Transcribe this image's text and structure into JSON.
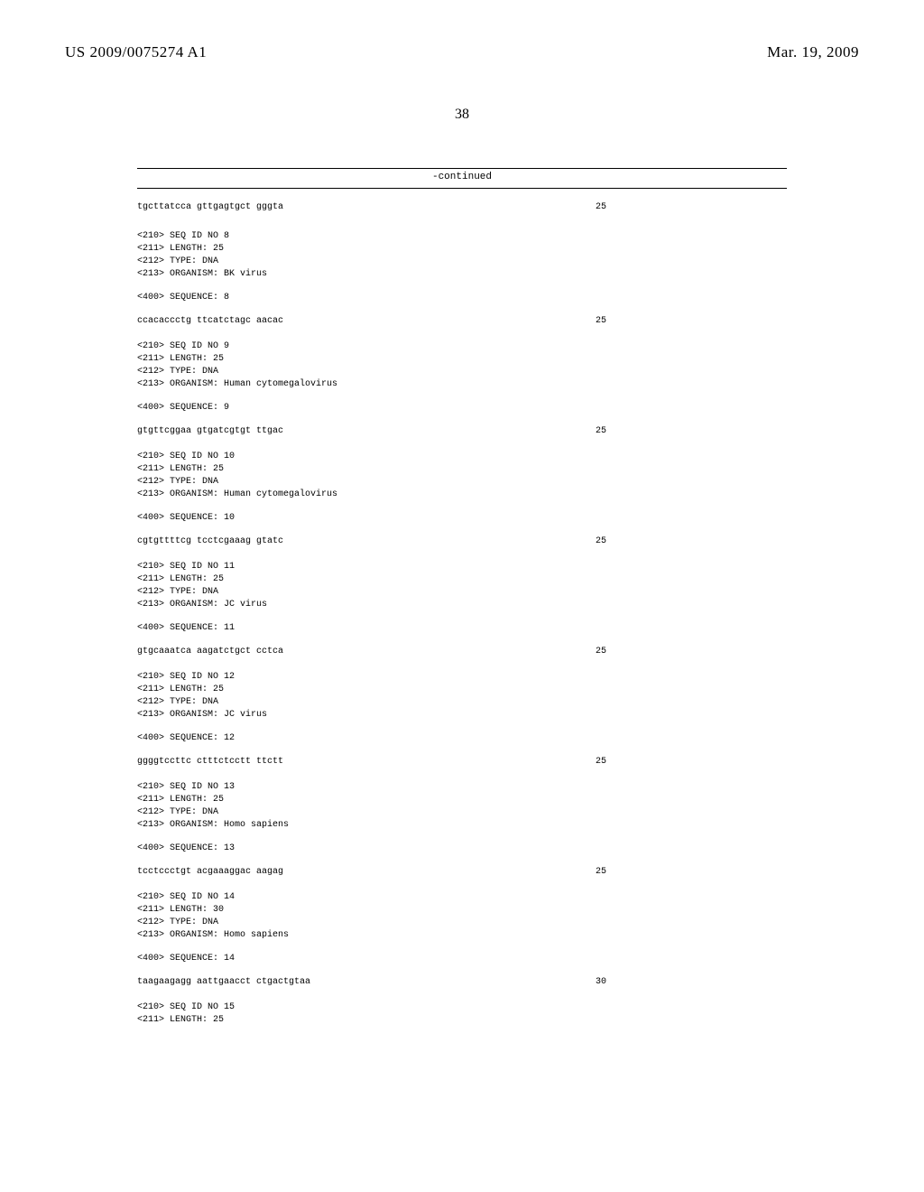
{
  "header": {
    "pub_number": "US 2009/0075274 A1",
    "pub_date": "Mar. 19, 2009"
  },
  "page_number": "38",
  "continued_label": "-continued",
  "first_seq": {
    "sequence": "tgcttatcca gttgagtgct gggta",
    "length": "25"
  },
  "blocks": [
    {
      "id_line": "<210> SEQ ID NO 8",
      "length_line": "<211> LENGTH: 25",
      "type_line": "<212> TYPE: DNA",
      "organism_line": "<213> ORGANISM: BK virus",
      "seq_label": "<400> SEQUENCE: 8",
      "sequence": "ccacaccctg ttcatctagc aacac",
      "length": "25"
    },
    {
      "id_line": "<210> SEQ ID NO 9",
      "length_line": "<211> LENGTH: 25",
      "type_line": "<212> TYPE: DNA",
      "organism_line": "<213> ORGANISM: Human cytomegalovirus",
      "seq_label": "<400> SEQUENCE: 9",
      "sequence": "gtgttcggaa gtgatcgtgt ttgac",
      "length": "25"
    },
    {
      "id_line": "<210> SEQ ID NO 10",
      "length_line": "<211> LENGTH: 25",
      "type_line": "<212> TYPE: DNA",
      "organism_line": "<213> ORGANISM: Human cytomegalovirus",
      "seq_label": "<400> SEQUENCE: 10",
      "sequence": "cgtgttttcg tcctcgaaag gtatc",
      "length": "25"
    },
    {
      "id_line": "<210> SEQ ID NO 11",
      "length_line": "<211> LENGTH: 25",
      "type_line": "<212> TYPE: DNA",
      "organism_line": "<213> ORGANISM: JC virus",
      "seq_label": "<400> SEQUENCE: 11",
      "sequence": "gtgcaaatca aagatctgct cctca",
      "length": "25"
    },
    {
      "id_line": "<210> SEQ ID NO 12",
      "length_line": "<211> LENGTH: 25",
      "type_line": "<212> TYPE: DNA",
      "organism_line": "<213> ORGANISM: JC virus",
      "seq_label": "<400> SEQUENCE: 12",
      "sequence": "ggggtccttc ctttctcctt ttctt",
      "length": "25"
    },
    {
      "id_line": "<210> SEQ ID NO 13",
      "length_line": "<211> LENGTH: 25",
      "type_line": "<212> TYPE: DNA",
      "organism_line": "<213> ORGANISM: Homo sapiens",
      "seq_label": "<400> SEQUENCE: 13",
      "sequence": "tcctccctgt acgaaaggac aagag",
      "length": "25"
    },
    {
      "id_line": "<210> SEQ ID NO 14",
      "length_line": "<211> LENGTH: 30",
      "type_line": "<212> TYPE: DNA",
      "organism_line": "<213> ORGANISM: Homo sapiens",
      "seq_label": "<400> SEQUENCE: 14",
      "sequence": "taagaagagg aattgaacct ctgactgtaa",
      "length": "30"
    }
  ],
  "trailing": {
    "id_line": "<210> SEQ ID NO 15",
    "length_line": "<211> LENGTH: 25"
  }
}
